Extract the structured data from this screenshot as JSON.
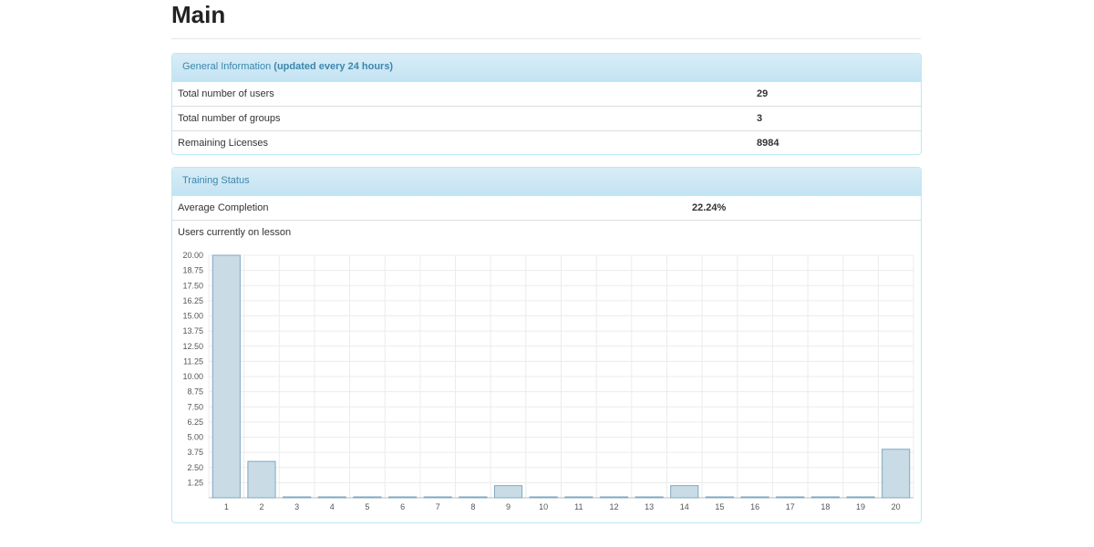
{
  "page": {
    "title": "Main"
  },
  "general": {
    "heading": "General Information",
    "heading_note": "(updated every 24 hours)",
    "rows": [
      {
        "label": "Total number of users",
        "value": "29"
      },
      {
        "label": "Total number of groups",
        "value": "3"
      },
      {
        "label": "Remaining Licenses",
        "value": "8984"
      }
    ]
  },
  "training": {
    "heading": "Training Status",
    "avg_label": "Average Completion",
    "avg_value": "22.24%",
    "users_label": "Users currently on lesson"
  },
  "chart_data": {
    "type": "bar",
    "categories": [
      "1",
      "2",
      "3",
      "4",
      "5",
      "6",
      "7",
      "8",
      "9",
      "10",
      "11",
      "12",
      "13",
      "14",
      "15",
      "16",
      "17",
      "18",
      "19",
      "20"
    ],
    "values": [
      20,
      3,
      0,
      0,
      0,
      0,
      0,
      0,
      1,
      0,
      0,
      0,
      0,
      1,
      0,
      0,
      0,
      0,
      0,
      4
    ],
    "y_ticks": [
      "1.25",
      "2.50",
      "3.75",
      "5.00",
      "6.25",
      "7.50",
      "8.75",
      "10.00",
      "11.25",
      "12.50",
      "13.75",
      "15.00",
      "16.25",
      "17.50",
      "18.75",
      "20.00"
    ],
    "ylim": [
      0,
      20
    ],
    "grid": true,
    "colors": {
      "bar_fill": "#c9dce6",
      "bar_stroke": "#7fa7c0",
      "grid": "#ececec"
    }
  }
}
